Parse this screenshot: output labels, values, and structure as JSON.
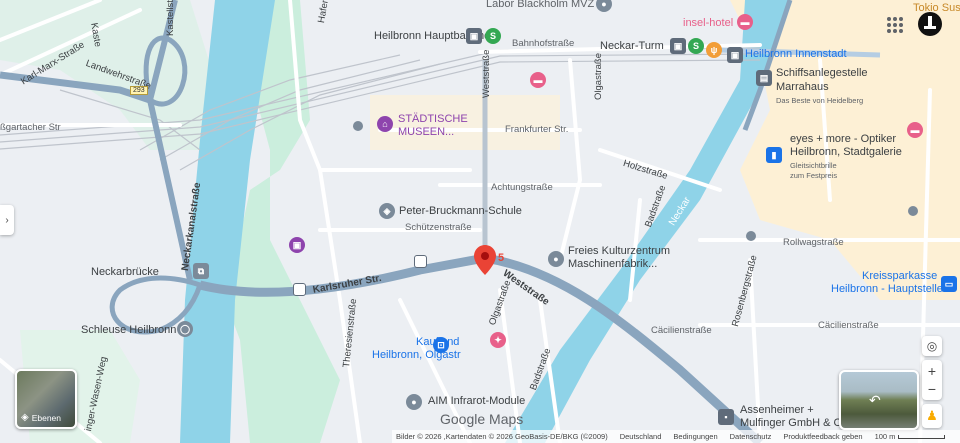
{
  "map": {
    "labels": {
      "labor": "Labor Blackholm MVZ",
      "insel_hotel": "insel-hotel",
      "tokio": "Tokio Sus",
      "hbf": "Heilbronn Hauptbahnhof",
      "bahnhofstrasse": "Bahnhofstraße",
      "neckar_turm": "Neckar-Turm",
      "innenstadt": "Heilbronn Innenstadt",
      "schiffsanlege": "Schiffsanlegestelle",
      "marrahaus": "Marrahaus",
      "marrahaus_sub": "Das Beste von Heidelberg",
      "staedtische": "STÄDTISCHE",
      "museen": "MUSEEN...",
      "frankfurter": "Frankfurter Str.",
      "eyes_more": "eyes + more - Optiker",
      "eyes_more2": "Heilbronn, Stadtgalerie",
      "eyes_more_sub1": "Gleitsichtbrille",
      "eyes_more_sub2": "zum Festpreis",
      "achtung": "Achtungstraße",
      "holzstrasse": "Holzstraße",
      "peter_bruckmann": "Peter-Bruckmann-Schule",
      "schuetzen": "Schützenstraße",
      "freies_1": "Freies Kulturzentrum",
      "freies_2": "Maschinenfabrik...",
      "rollwag": "Rollwagstraße",
      "neckarbruecke": "Neckarbrücke",
      "karlsruher": "Karlsruher Str.",
      "weststrasse_top": "Weststraße",
      "weststrasse": "Weststraße",
      "olgastrasse_top": "Olgastraße",
      "olgastrasse": "Olgastraße",
      "kreissparkasse_1": "Kreissparkasse",
      "kreissparkasse_2": "Heilbronn - Hauptstelle",
      "schleuse": "Schleuse Heilbronn",
      "kaufland_1": "Kaufland",
      "kaufland_2": "Heilbronn, Olgastr",
      "caecilien_1": "Cäcilienstraße",
      "caecilien_2": "Cäcilienstraße",
      "rosenberg": "Rosenbergstraße",
      "badstrasse_1": "Badstraße",
      "badstrasse_2": "Badstraße",
      "neckar": "Neckar",
      "aim": "AIM Infrarot-Module",
      "assenheimer_1": "Assenheimer +",
      "assenheimer_2": "Mulfinger GmbH & Co",
      "karl_marx": "Karl-Marx-Straße",
      "landwehr": "Landwehrstraße",
      "bgartacher": "ßgartacher Str",
      "kaste": "Kaste",
      "kastell": "Kastellstraße",
      "hafen": "Hafen",
      "neckarkanal": "Neckarkanalstraße",
      "theresien": "Theresienstraße",
      "hanger_weg": "inger-Wasen-Weg",
      "road_293": "293",
      "pin_number": "5",
      "google_maps": "Google Maps"
    },
    "layers_button": "Ebenen"
  },
  "footer": {
    "imagery": "Bilder © 2026 ,Kartendaten © 2026 GeoBasis-DE/BKG (©2009)",
    "country": "Deutschland",
    "terms": "Bedingungen",
    "privacy": "Datenschutz",
    "feedback": "Produktfeedback geben",
    "scale": "100 m"
  },
  "colors": {
    "water": "#8fd3e8",
    "park": "#cbeedd",
    "highway": "#8aa5be",
    "road": "#ffffff",
    "rail": "#bfc4cc",
    "built": "#fdf0d5",
    "pin": "#ea4335",
    "transit_green": "#34a853"
  },
  "icons": [
    "apps-grid-icon",
    "account-icon",
    "layers-icon",
    "my-location-icon",
    "zoom-in-icon",
    "zoom-out-icon",
    "pegman-icon",
    "collapse-panel-icon"
  ]
}
